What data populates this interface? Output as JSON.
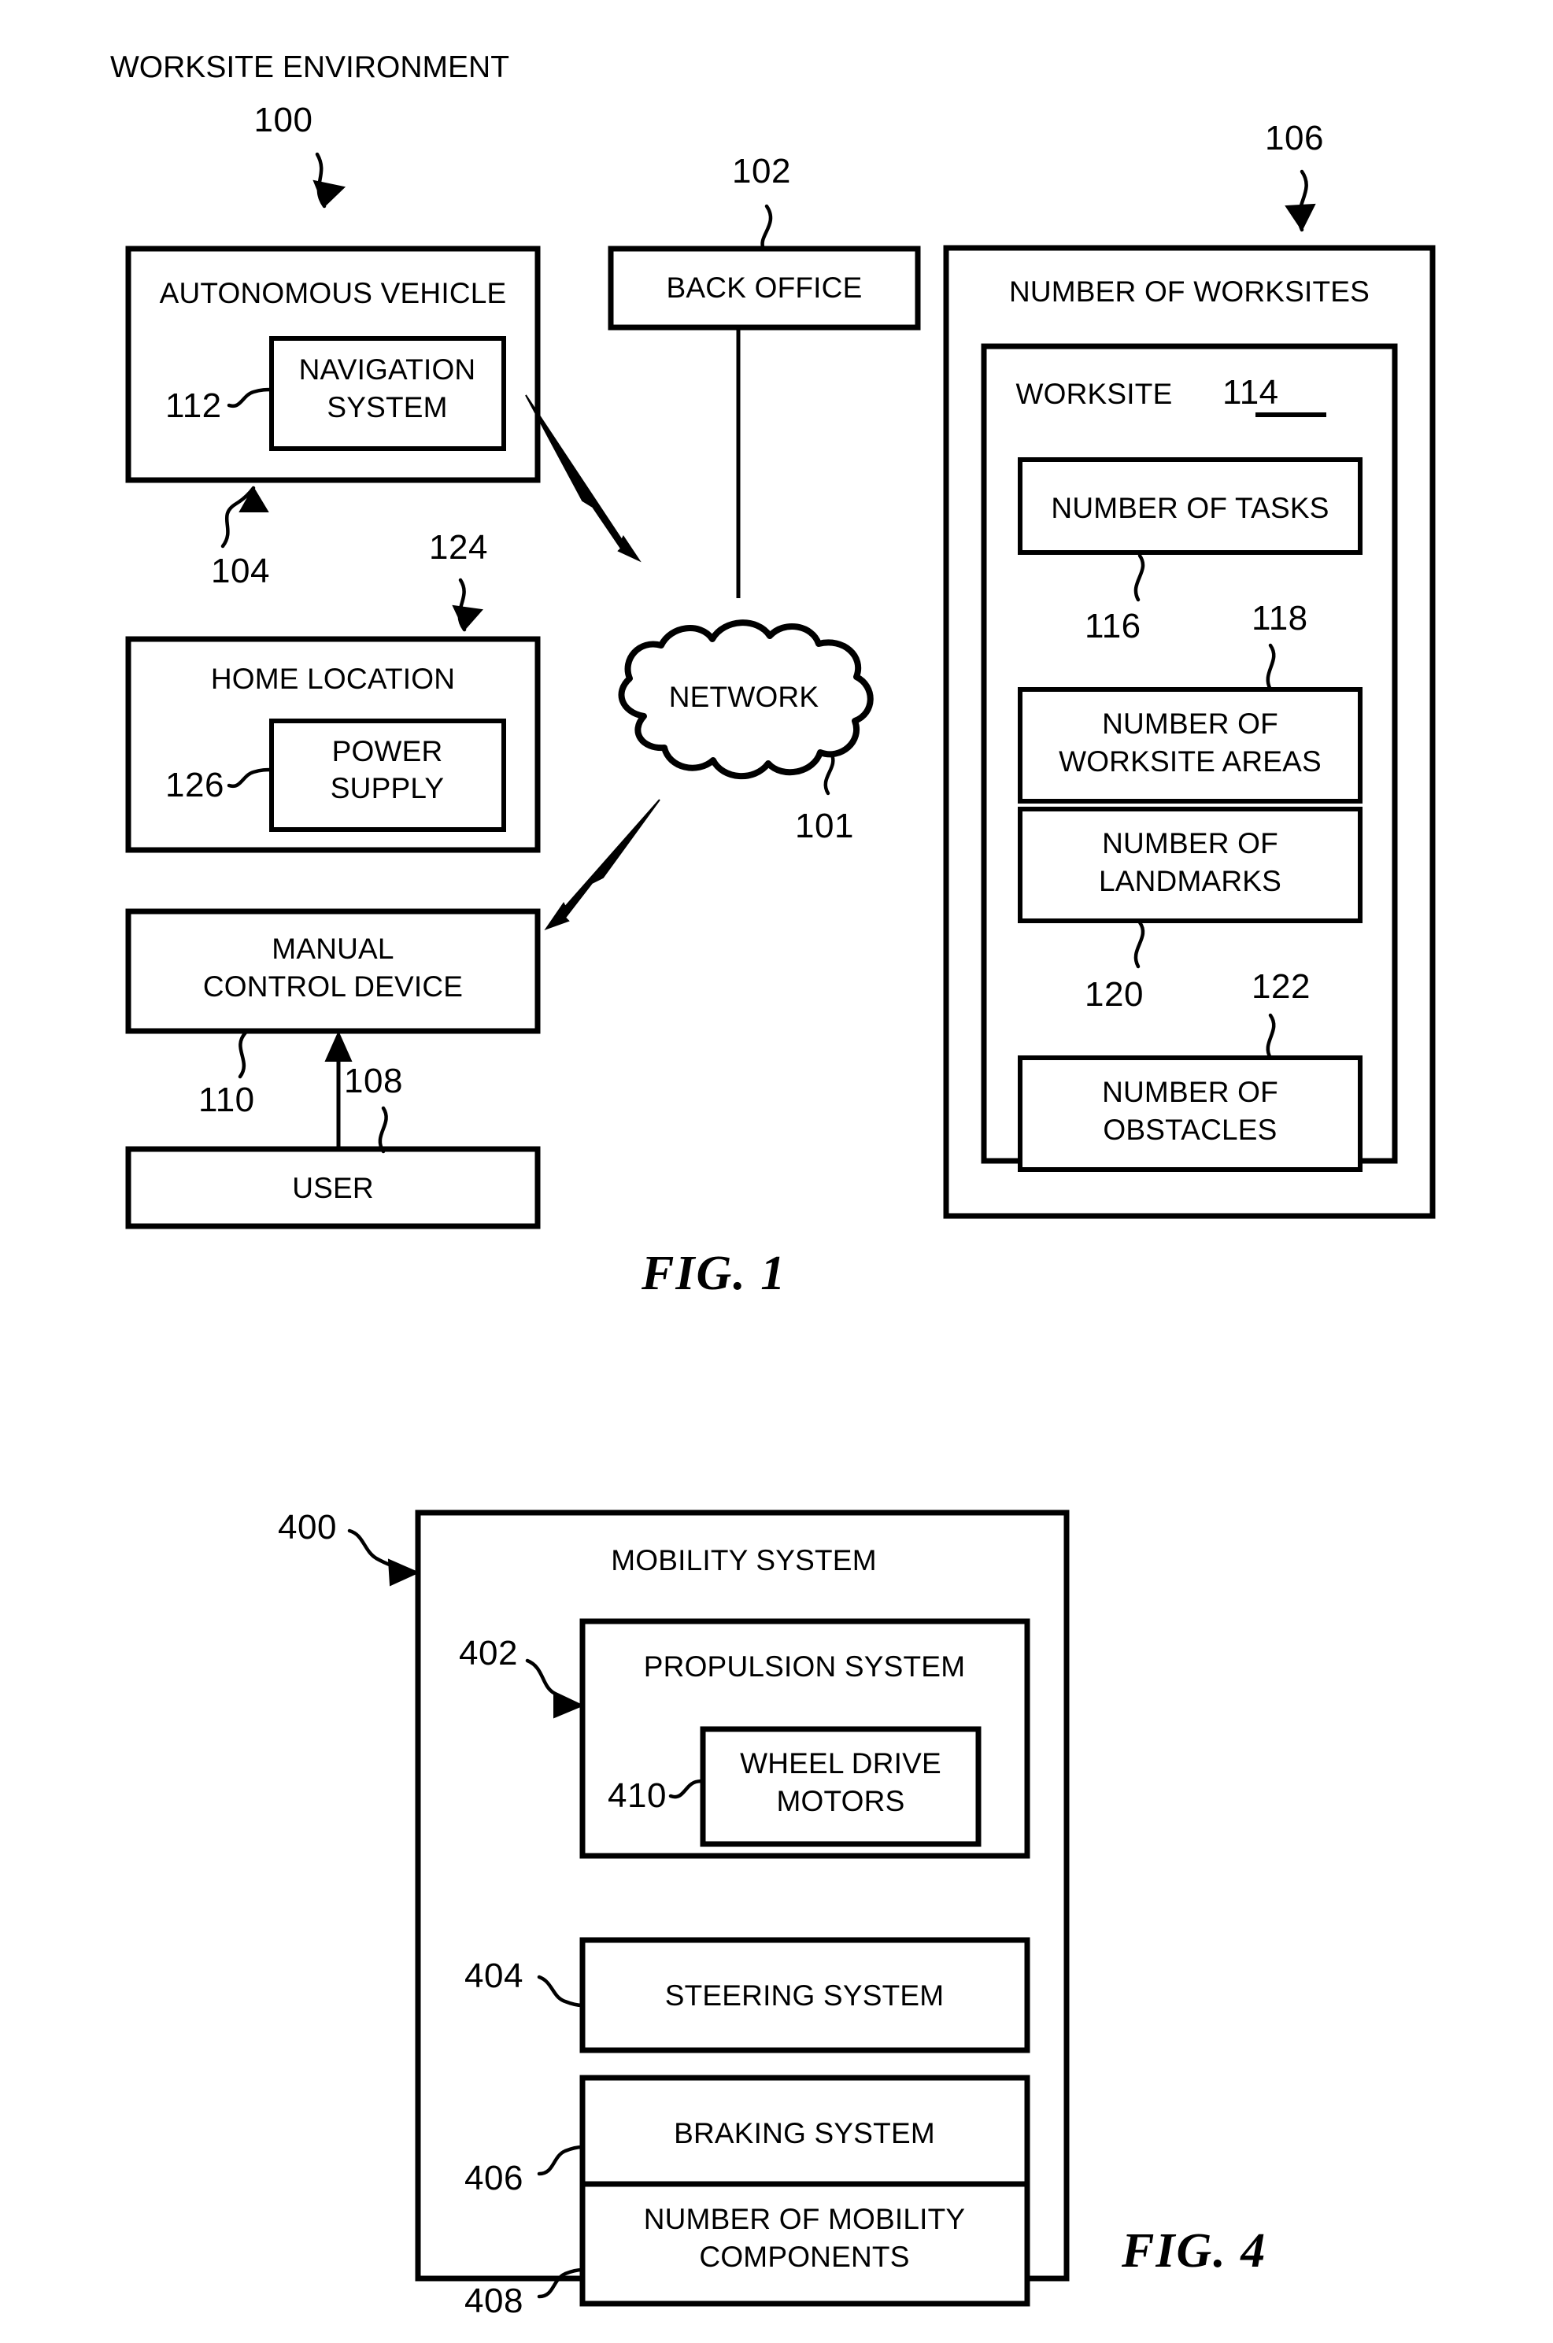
{
  "figure1": {
    "caption": "FIG. 1",
    "environment_title": "WORKSITE ENVIRONMENT",
    "environment_ref": "100",
    "autonomous_vehicle": {
      "label": "AUTONOMOUS VEHICLE",
      "ref": "104",
      "child": {
        "label_line1": "NAVIGATION",
        "label_line2": "SYSTEM",
        "ref": "112"
      }
    },
    "home_location": {
      "label": "HOME LOCATION",
      "ref": "124",
      "child": {
        "label_line1": "POWER",
        "label_line2": "SUPPLY",
        "ref": "126"
      }
    },
    "manual_control_device": {
      "label_line1": "MANUAL",
      "label_line2": "CONTROL DEVICE",
      "ref": "110"
    },
    "user": {
      "label": "USER",
      "ref": "108"
    },
    "back_office": {
      "label": "BACK OFFICE",
      "ref": "102"
    },
    "network": {
      "label": "NETWORK",
      "ref": "101"
    },
    "worksites": {
      "label": "NUMBER OF WORKSITES",
      "ref": "106",
      "worksite": {
        "label": "WORKSITE",
        "ref": "114",
        "items": [
          {
            "label_line1": "NUMBER OF TASKS",
            "label_line2": "",
            "ref": "116"
          },
          {
            "label_line1": "NUMBER OF",
            "label_line2": "WORKSITE AREAS",
            "ref": "118"
          },
          {
            "label_line1": "NUMBER OF",
            "label_line2": "LANDMARKS",
            "ref": "120"
          },
          {
            "label_line1": "NUMBER OF",
            "label_line2": "OBSTACLES",
            "ref": "122"
          }
        ]
      }
    }
  },
  "figure4": {
    "caption": "FIG. 4",
    "mobility_system": {
      "label": "MOBILITY SYSTEM",
      "ref": "400"
    },
    "propulsion_system": {
      "label": "PROPULSION SYSTEM",
      "ref": "402"
    },
    "wheel_drive_motors": {
      "label_line1": "WHEEL DRIVE",
      "label_line2": "MOTORS",
      "ref": "410"
    },
    "steering_system": {
      "label": "STEERING SYSTEM",
      "ref": "404"
    },
    "braking_system": {
      "label": "BRAKING SYSTEM",
      "ref": "406"
    },
    "mobility_components": {
      "label_line1": "NUMBER OF MOBILITY",
      "label_line2": "COMPONENTS",
      "ref": "408"
    }
  },
  "colors": {
    "ink": "#000000",
    "paper": "#ffffff"
  }
}
